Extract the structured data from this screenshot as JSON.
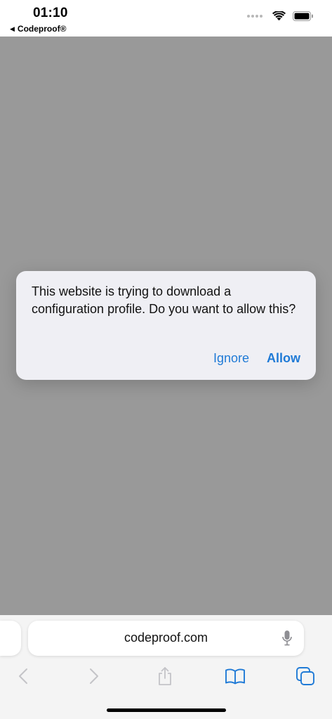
{
  "status_bar": {
    "time": "01:10",
    "back_app": "Codeproof®"
  },
  "alert": {
    "message": "This website is trying to download a configuration profile. Do you want to allow this?",
    "ignore_label": "Ignore",
    "allow_label": "Allow"
  },
  "browser": {
    "address": "codeproof.com"
  },
  "icons": {
    "back_triangle": "back-triangle-icon",
    "wifi": "wifi-icon",
    "battery": "battery-icon",
    "mic": "microphone-icon",
    "back": "chevron-left-icon",
    "forward": "chevron-right-icon",
    "share": "share-icon",
    "bookmarks": "book-icon",
    "tabs": "tabs-icon"
  },
  "colors": {
    "accent": "#1f7ad6",
    "dim_overlay": "#999999",
    "alert_bg": "#efeff4"
  }
}
